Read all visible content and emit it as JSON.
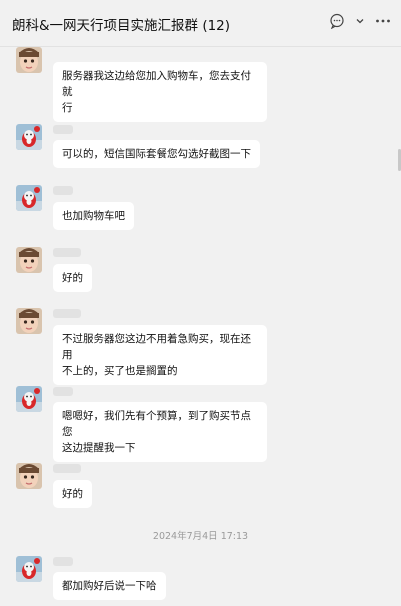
{
  "header": {
    "title": "朗科&一网天行项目实施汇报群 (12)",
    "icons": [
      "chat-bubble-icon",
      "chevron-down-icon",
      "more-icon"
    ]
  },
  "messages": [
    {
      "sender": "child",
      "text_lines": [
        "服务器我这边给您加入购物车，您去支付就",
        "行"
      ]
    },
    {
      "sender": "cartoon",
      "text_lines": [
        "可以的，短信国际套餐您勾选好截图一下"
      ]
    },
    {
      "sender": "cartoon",
      "text_lines": [
        "也加购物车吧"
      ]
    },
    {
      "sender": "child",
      "text_lines": [
        "好的"
      ]
    },
    {
      "sender": "child",
      "text_lines": [
        "不过服务器您这边不用着急购买，现在还用",
        "不上的，买了也是搁置的"
      ]
    },
    {
      "sender": "cartoon",
      "text_lines": [
        "嗯嗯好，我们先有个预算，到了购买节点您",
        "这边提醒我一下"
      ]
    },
    {
      "sender": "child",
      "text_lines": [
        "好的"
      ]
    },
    {
      "sender": "cartoon",
      "text_lines": [
        "都加购好后说一下哈"
      ]
    }
  ],
  "timestamp": "2024年7月4日 17:13",
  "colors": {
    "background": "#f1f1f1",
    "bubble": "#ffffff",
    "timestamp": "#9a9a9a"
  }
}
